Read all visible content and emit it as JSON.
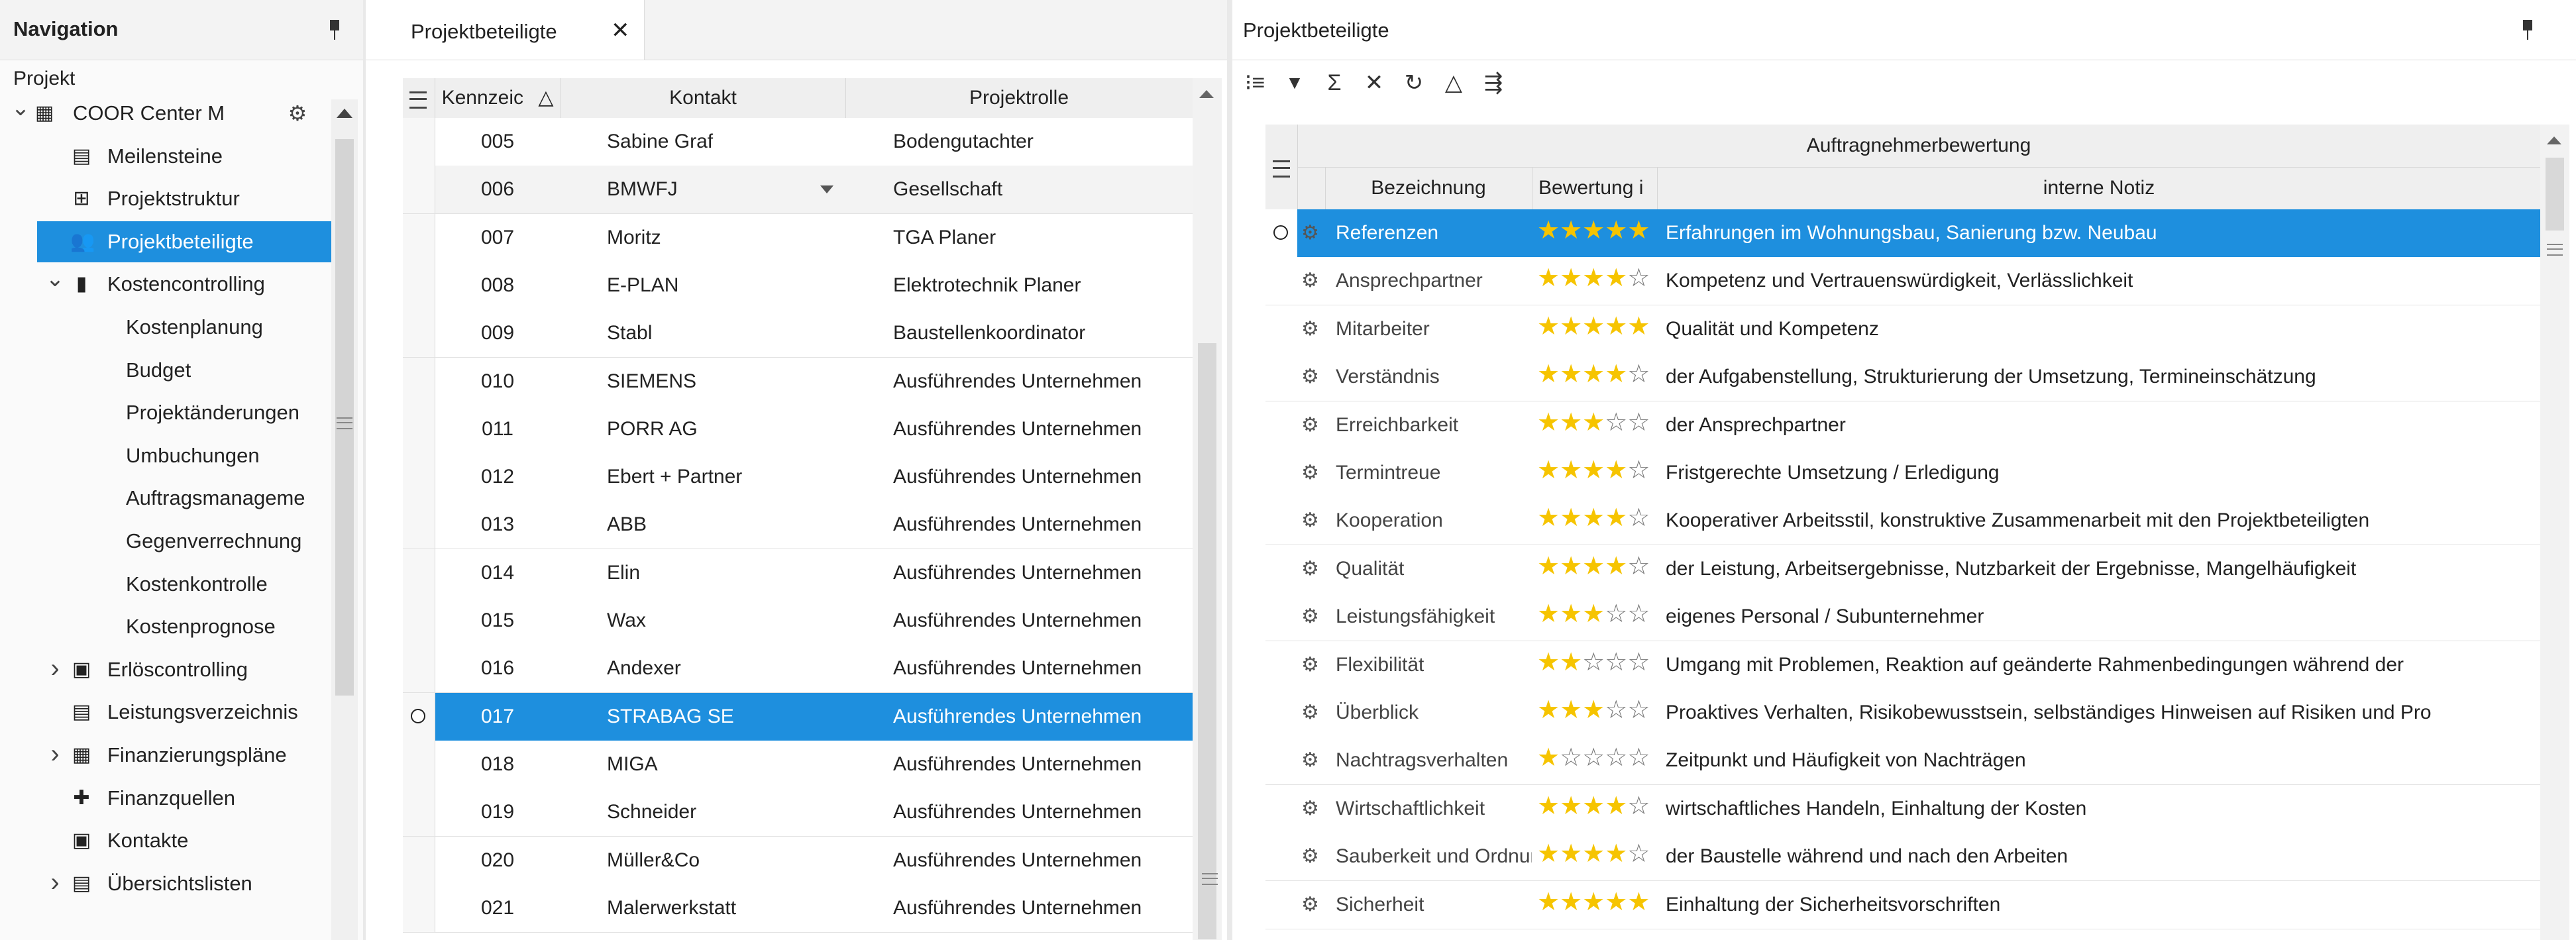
{
  "nav": {
    "title": "Navigation",
    "section": "Projekt",
    "items": [
      {
        "label": "COOR Center M",
        "icon": "building-icon",
        "glyph": "▦",
        "level": 0,
        "toggle": "v",
        "settings": true
      },
      {
        "label": "Meilensteine",
        "icon": "calendar-icon",
        "glyph": "▤",
        "level": 1
      },
      {
        "label": "Projektstruktur",
        "icon": "structure-icon",
        "glyph": "⊞",
        "level": 1
      },
      {
        "label": "Projektbeteiligte",
        "icon": "people-icon",
        "glyph": "👥",
        "level": 1,
        "selected": true
      },
      {
        "label": "Kostencontrolling",
        "icon": "bar-chart-icon",
        "glyph": "▮",
        "level": 1,
        "toggle": "v"
      },
      {
        "label": "Kostenplanung",
        "level": 2
      },
      {
        "label": "Budget",
        "level": 2
      },
      {
        "label": "Projektänderungen",
        "level": 2
      },
      {
        "label": "Umbuchungen",
        "level": 2
      },
      {
        "label": "Auftragsmanageme",
        "level": 2
      },
      {
        "label": "Gegenverrechnung",
        "level": 2
      },
      {
        "label": "Kostenkontrolle",
        "level": 2
      },
      {
        "label": "Kostenprognose",
        "level": 2
      },
      {
        "label": "Erlöscontrolling",
        "icon": "money-icon",
        "glyph": "▣",
        "level": 1,
        "toggle": ">"
      },
      {
        "label": "Leistungsverzeichnis",
        "icon": "document-icon",
        "glyph": "▤",
        "level": 1
      },
      {
        "label": "Finanzierungspläne",
        "icon": "calendar-icon",
        "glyph": "▦",
        "level": 1,
        "toggle": ">"
      },
      {
        "label": "Finanzquellen",
        "icon": "add-person-icon",
        "glyph": "✚",
        "level": 1
      },
      {
        "label": "Kontakte",
        "icon": "contact-card-icon",
        "glyph": "▣",
        "level": 1
      },
      {
        "label": "Übersichtslisten",
        "icon": "list-icon",
        "glyph": "▤",
        "level": 1,
        "toggle": ">"
      }
    ]
  },
  "mid": {
    "tab_label": "Projektbeteiligte",
    "tab_close": "✕",
    "columns": [
      "Kennzeic",
      "Kontakt",
      "Projektrolle"
    ],
    "sort_glyph": "△",
    "rows": [
      {
        "id": "005",
        "kontakt": "Sabine Graf",
        "rolle": "Bodengutachter"
      },
      {
        "id": "006",
        "kontakt": "BMWFJ",
        "rolle": "Gesellschaft",
        "editing": true
      },
      {
        "id": "007",
        "kontakt": "Moritz",
        "rolle": "TGA Planer"
      },
      {
        "id": "008",
        "kontakt": "E-PLAN",
        "rolle": "Elektrotechnik Planer"
      },
      {
        "id": "009",
        "kontakt": "Stabl",
        "rolle": "Baustellenkoordinator"
      },
      {
        "id": "010",
        "kontakt": "SIEMENS",
        "rolle": "Ausführendes Unternehmen"
      },
      {
        "id": "011",
        "kontakt": "PORR AG",
        "rolle": "Ausführendes Unternehmen"
      },
      {
        "id": "012",
        "kontakt": "Ebert + Partner",
        "rolle": "Ausführendes Unternehmen"
      },
      {
        "id": "013",
        "kontakt": "ABB",
        "rolle": "Ausführendes Unternehmen"
      },
      {
        "id": "014",
        "kontakt": "Elin",
        "rolle": "Ausführendes Unternehmen"
      },
      {
        "id": "015",
        "kontakt": "Wax",
        "rolle": "Ausführendes Unternehmen"
      },
      {
        "id": "016",
        "kontakt": "Andexer",
        "rolle": "Ausführendes Unternehmen"
      },
      {
        "id": "017",
        "kontakt": "STRABAG SE",
        "rolle": "Ausführendes Unternehmen",
        "selected": true
      },
      {
        "id": "018",
        "kontakt": "MIGA",
        "rolle": "Ausführendes Unternehmen"
      },
      {
        "id": "019",
        "kontakt": "Schneider",
        "rolle": "Ausführendes Unternehmen"
      },
      {
        "id": "020",
        "kontakt": "Müller&Co",
        "rolle": "Ausführendes Unternehmen"
      },
      {
        "id": "021",
        "kontakt": "Malerwerkstatt",
        "rolle": "Ausführendes Unternehmen"
      }
    ]
  },
  "right": {
    "title": "Projektbeteiligte",
    "toolbar": [
      {
        "name": "tree-view-icon",
        "glyph": "⁝≡"
      },
      {
        "name": "filter-icon",
        "glyph": "▼"
      },
      {
        "name": "sum-icon",
        "glyph": "Σ"
      },
      {
        "name": "clear-icon",
        "glyph": "✕"
      },
      {
        "name": "refresh-icon",
        "glyph": "↻"
      },
      {
        "name": "warning-icon",
        "glyph": "△"
      },
      {
        "name": "export-icon",
        "glyph": "⇶"
      }
    ],
    "group_header": "Auftragnehmerbewertung",
    "columns": [
      "Bezeichnung",
      "Bewertung i",
      "interne Notiz"
    ],
    "rows": [
      {
        "bez": "Referenzen",
        "rating": 5,
        "notiz": "Erfahrungen im Wohnungsbau, Sanierung bzw. Neubau",
        "selected": true
      },
      {
        "bez": "Ansprechpartner",
        "rating": 4,
        "notiz": "Kompetenz und Vertrauenswürdigkeit, Verlässlichkeit"
      },
      {
        "bez": "Mitarbeiter",
        "rating": 5,
        "notiz": "Qualität und Kompetenz"
      },
      {
        "bez": "Verständnis",
        "rating": 4,
        "notiz": "der Aufgabenstellung, Strukturierung der Umsetzung, Termineinschätzung"
      },
      {
        "bez": "Erreichbarkeit",
        "rating": 3,
        "notiz": "der Ansprechpartner"
      },
      {
        "bez": "Termintreue",
        "rating": 4,
        "notiz": "Fristgerechte Umsetzung / Erledigung"
      },
      {
        "bez": "Kooperation",
        "rating": 4,
        "notiz": "Kooperativer Arbeitsstil, konstruktive Zusammenarbeit mit den Projektbeteiligten"
      },
      {
        "bez": "Qualität",
        "rating": 4,
        "notiz": "der Leistung, Arbeitsergebnisse, Nutzbarkeit der Ergebnisse, Mangelhäufigkeit"
      },
      {
        "bez": "Leistungsfähigkeit",
        "rating": 3,
        "notiz": "eigenes Personal / Subunternehmer"
      },
      {
        "bez": "Flexibilität",
        "rating": 2,
        "notiz": "Umgang mit Problemen, Reaktion auf geänderte Rahmenbedingungen während der"
      },
      {
        "bez": "Überblick",
        "rating": 3,
        "notiz": "Proaktives Verhalten, Risikobewusstsein, selbständiges Hinweisen auf Risiken und Pro"
      },
      {
        "bez": "Nachtragsverhalten",
        "rating": 1,
        "notiz": "Zeitpunkt und Häufigkeit von Nachträgen"
      },
      {
        "bez": "Wirtschaftlichkeit",
        "rating": 4,
        "notiz": "wirtschaftliches Handeln, Einhaltung der Kosten"
      },
      {
        "bez": "Sauberkeit und Ordnung",
        "rating": 4,
        "notiz": "der Baustelle während und nach den Arbeiten"
      },
      {
        "bez": "Sicherheit",
        "rating": 5,
        "notiz": "Einhaltung der Sicherheitsvorschriften"
      }
    ]
  }
}
